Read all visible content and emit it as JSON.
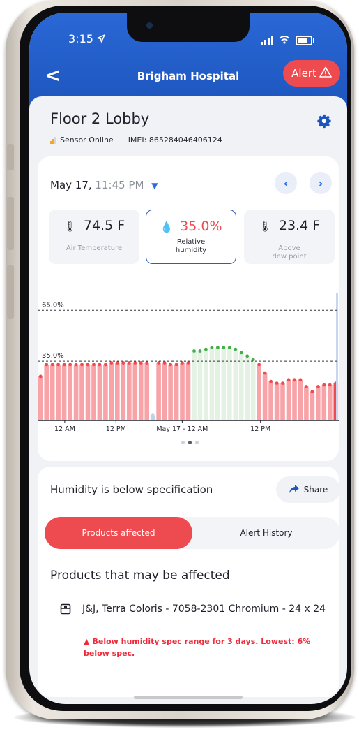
{
  "status": {
    "time": "3:15"
  },
  "header": {
    "back": "<",
    "title": "Brigham Hospital",
    "alert_label": "Alert"
  },
  "location": {
    "name": "Floor 2 Lobby",
    "sensor_status": "Sensor Online",
    "imei": "IMEI: 865284046406124"
  },
  "reading": {
    "date": "May 17,",
    "time": "11:45 PM"
  },
  "metrics": [
    {
      "value": "74.5 F",
      "label": "Air Temperature"
    },
    {
      "value": "35.0%",
      "label": "Relative humidity"
    },
    {
      "value": "23.4 F",
      "label": "Above dew point"
    }
  ],
  "chart_data": {
    "type": "bar",
    "reference_lines": [
      {
        "label": "65.0%",
        "value": 65
      },
      {
        "label": "35.0%",
        "value": 35
      }
    ],
    "x_tick_labels": [
      "12 AM",
      "12 PM",
      "May 17 - 12 AM",
      "12 PM"
    ],
    "ylim": [
      0,
      75
    ],
    "values": [
      26,
      33,
      33,
      33,
      33,
      33,
      33,
      33,
      33,
      33,
      33,
      33,
      34,
      34,
      34,
      34,
      34,
      34,
      34,
      3,
      34,
      34,
      33,
      33,
      34,
      34,
      41,
      41,
      42,
      43,
      43,
      43,
      43,
      42,
      40,
      38,
      36,
      33,
      28,
      23,
      22,
      22,
      24,
      24,
      24,
      20,
      17,
      20,
      21,
      21,
      22
    ],
    "status_colors": {
      "below_spec": "#f26e76",
      "in_spec": "#42b04a",
      "selected": "#2d5bb5"
    }
  },
  "alert": {
    "message": "Humidity is below specification",
    "share_label": "Share"
  },
  "tabs": [
    {
      "label": "Products affected",
      "active": true
    },
    {
      "label": "Alert History",
      "active": false
    }
  ],
  "products": {
    "heading": "Products that may be affected",
    "items": [
      {
        "name": "J&J, Terra Coloris - 7058-2301 Chromium - 24 x 24",
        "warning": "Below humidity spec range for 3 days. Lowest: 6% below spec."
      }
    ]
  },
  "colors": {
    "header_blue": "#1d55bd",
    "alert_red": "#ee4b51",
    "accent_blue": "#2a6ae0"
  }
}
